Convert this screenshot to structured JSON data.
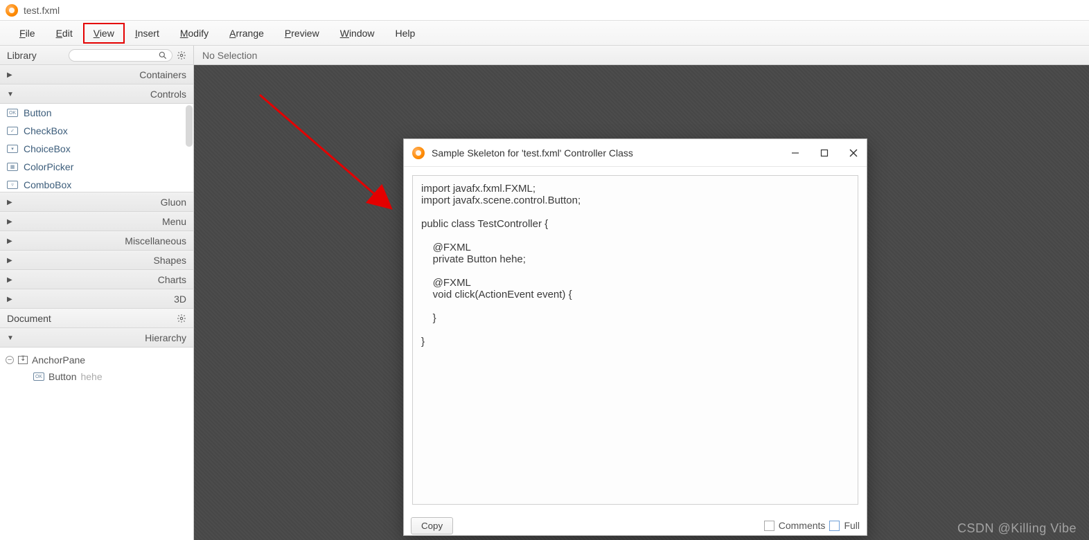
{
  "title": "test.fxml",
  "menu": {
    "file": "File",
    "edit": "Edit",
    "view": "View",
    "insert": "Insert",
    "modify": "Modify",
    "arrange": "Arrange",
    "preview": "Preview",
    "window": "Window",
    "help": "Help"
  },
  "library": {
    "label": "Library",
    "sections": {
      "containers": "Containers",
      "controls": "Controls",
      "gluon": "Gluon",
      "menuSect": "Menu",
      "misc": "Miscellaneous",
      "shapes": "Shapes",
      "charts": "Charts",
      "threeD": "3D"
    },
    "controls_items": [
      {
        "label": "Button",
        "glyph": "OK"
      },
      {
        "label": "CheckBox",
        "glyph": "✓"
      },
      {
        "label": "ChoiceBox",
        "glyph": "▾"
      },
      {
        "label": "ColorPicker",
        "glyph": "▦"
      },
      {
        "label": "ComboBox",
        "glyph": "▿"
      }
    ]
  },
  "document": {
    "label": "Document",
    "hierarchy_label": "Hierarchy",
    "root": {
      "type": "AnchorPane"
    },
    "child": {
      "type": "Button",
      "fxid": "hehe"
    }
  },
  "selection_bar": "No Selection",
  "dialog": {
    "title": "Sample Skeleton for 'test.fxml' Controller Class",
    "code": "import javafx.fxml.FXML;\nimport javafx.scene.control.Button;\n\npublic class TestController {\n\n    @FXML\n    private Button hehe;\n\n    @FXML\n    void click(ActionEvent event) {\n\n    }\n\n}",
    "copy": "Copy",
    "comments": "Comments",
    "full": "Full"
  },
  "watermark": "CSDN @Killing Vibe"
}
